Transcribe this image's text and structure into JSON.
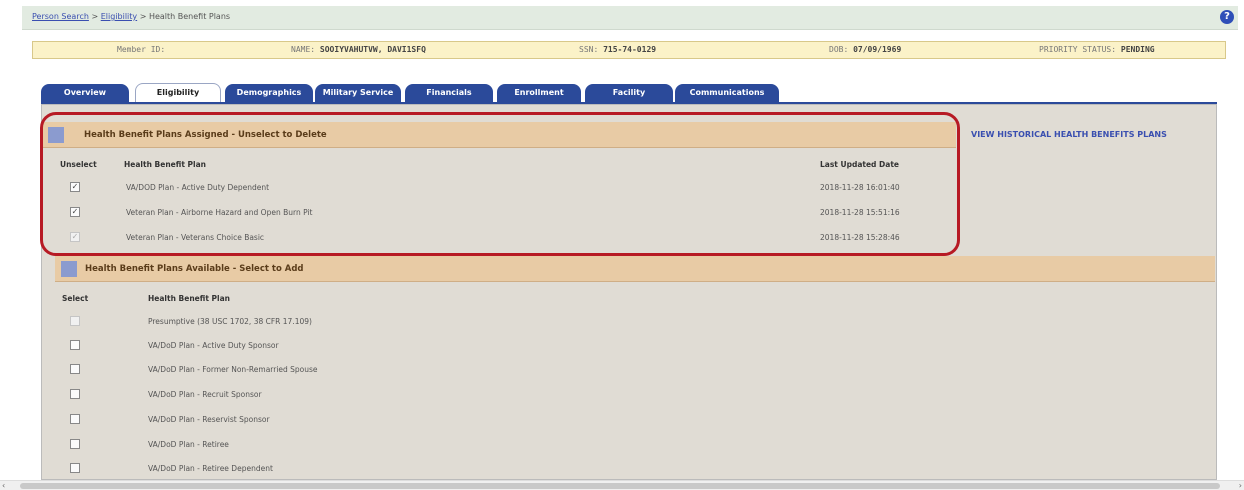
{
  "breadcrumb": {
    "items": [
      "Person Search",
      "Eligibility",
      "Health Benefit Plans"
    ],
    "sep": ">"
  },
  "member": {
    "member_id": "Member ID:",
    "name_label": "NAME:",
    "name_value": "SOOIYVAHUTVW, DAVI1SFQ",
    "ssn_label": "SSN:",
    "ssn_value": "715-74-0129",
    "dob_label": "DOB:",
    "dob_value": "07/09/1969",
    "priority_label": "PRIORITY STATUS:",
    "priority_value": "PENDING"
  },
  "tabs": [
    "Overview",
    "Eligibility",
    "Demographics",
    "Military Service",
    "Financials",
    "Enrollment",
    "Facility",
    "Communications"
  ],
  "assigned": {
    "title": "Health Benefit Plans Assigned - Unselect to Delete",
    "history_link": "VIEW HISTORICAL HEALTH BENEFITS PLANS",
    "col_unselect": "Unselect",
    "col_plan": "Health Benefit Plan",
    "col_date": "Last Updated Date",
    "rows": [
      {
        "plan": "VA/DOD Plan - Active Duty Dependent",
        "date": "2018-11-28 16:01:40",
        "checked": "✓"
      },
      {
        "plan": "Veteran Plan - Airborne Hazard and Open Burn Pit",
        "date": "2018-11-28 15:51:16",
        "checked": "✓"
      },
      {
        "plan": "Veteran Plan - Veterans Choice Basic",
        "date": "2018-11-28 15:28:46",
        "checked": "✓"
      }
    ]
  },
  "available": {
    "title": "Health Benefit Plans Available - Select to Add",
    "col_select": "Select",
    "col_plan": "Health Benefit Plan",
    "rows": [
      {
        "plan": "Presumptive (38 USC 1702, 38 CFR 17.109)"
      },
      {
        "plan": "VA/DoD Plan - Active Duty Sponsor"
      },
      {
        "plan": "VA/DoD Plan - Former Non-Remarried Spouse"
      },
      {
        "plan": "VA/DoD Plan - Recruit Sponsor"
      },
      {
        "plan": "VA/DoD Plan - Reservist Sponsor"
      },
      {
        "plan": "VA/DoD Plan - Retiree"
      },
      {
        "plan": "VA/DoD Plan - Retiree Dependent"
      }
    ]
  },
  "colors": {
    "accent": "#b71a24",
    "tab_blue": "#2b4a9a",
    "section_header": "#e8cba5"
  },
  "icons": {
    "help": "?",
    "scroll_left": "‹",
    "scroll_right": "›"
  }
}
